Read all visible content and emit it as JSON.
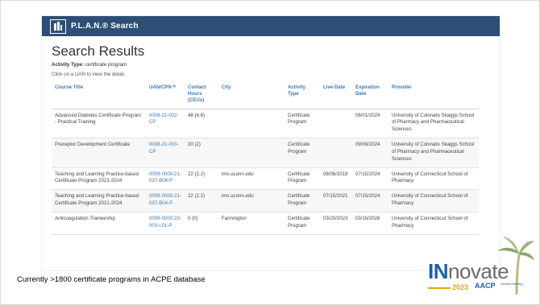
{
  "header": {
    "title": "P.L.A.N.® Search"
  },
  "page": {
    "heading": "Search Results",
    "activity_type_label": "Activity Type:",
    "activity_type_value": "certificate program",
    "hint": "Click on a UAN to view the detail."
  },
  "table": {
    "columns": [
      "Course Title",
      "UAN/CPN",
      "Contact Hours (CEUs)",
      "City",
      "Activity Type",
      "Live Date",
      "Expiration Date",
      "Provider"
    ],
    "sort_indicator": "^",
    "rows": [
      [
        "Advanced Diabetes Certificate Program - Practical Training",
        "0008-21-002-CP",
        "48 (4.8)",
        "",
        "Certificate Program",
        "",
        "06/01/2024",
        "University of Colorado Skaggs School of Pharmacy and Pharmaceutical Sciences"
      ],
      [
        "Preceptor Development Certificate",
        "0008-21-003-CP",
        "20 (2)",
        "",
        "Certificate Program",
        "",
        "09/08/2024",
        "University of Colorado Skaggs School of Pharmacy and Pharmaceutical Sciences"
      ],
      [
        "Teaching and Learning Practice-based Certificate Program 2021-2024",
        "0009-0000-21-037-B04-P",
        "22 (2.2)",
        "lms.uconn.edu",
        "Certificate Program",
        "08/06/2018",
        "07/15/2024",
        "University of Connecticut School of Pharmacy"
      ],
      [
        "Teaching and Learning Practice-based Certificate Program 2021-2024",
        "0009-0000-21-037-B04-P",
        "22 (2.2)",
        "lms.uconn.edu",
        "Certificate Program",
        "07/15/2021",
        "07/15/2024",
        "University of Connecticut School of Pharmacy"
      ],
      [
        "Anticoagulation Traineeship",
        "0009-0000-23-003-L01-P",
        "0 (0)",
        "Farmington",
        "Certificate Program",
        "03/20/2023",
        "03/16/2026",
        "University of Connecticut School of Pharmacy"
      ]
    ]
  },
  "caption": "Currently >1800 certificate programs in ACPE database",
  "brand": {
    "in": "IN",
    "novate": "novate",
    "year": "2023",
    "aacp": "AACP",
    "tag": "Interim Meeting"
  },
  "colors": {
    "header_bar": "#2d4f76",
    "link": "#3a78b5",
    "brand_blue": "#1f5ea8",
    "brand_gold": "#e8a21c"
  }
}
